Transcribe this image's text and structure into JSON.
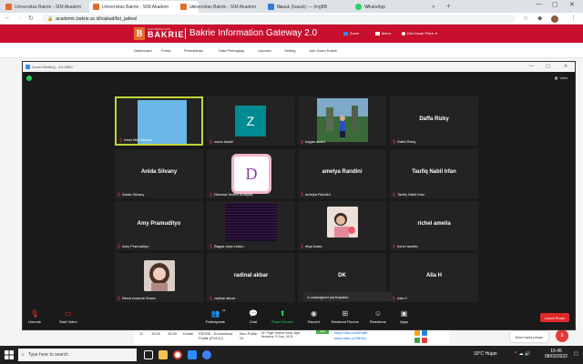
{
  "browser": {
    "tabs": [
      {
        "title": "Universitas Bakrie - SIM Akadem",
        "color": "#e46b2e",
        "active": false
      },
      {
        "title": "Universitas Bakrie - SIM Akadem",
        "color": "#e46b2e",
        "active": true
      },
      {
        "title": "Universitas Bakrie - SIM Akadem",
        "color": "#e46b2e",
        "active": false
      },
      {
        "title": "Baauk (baauk) — ImgBB",
        "color": "#2e7bd6",
        "active": false
      },
      {
        "title": "WhatsApp",
        "color": "#25d366",
        "active": false
      }
    ],
    "url": "academic.bakrie.ac.id/siakad/list_jadwal"
  },
  "site": {
    "logo_small": "UNIVERSITAS",
    "logo_big": "BAKRIE",
    "gateway_title": "Bakrie Information Gateway 2.0",
    "header_items": [
      "Zoom",
      "Menu",
      "Deri Ihsan Putra"
    ],
    "nav": [
      "Dashboard",
      "Portal",
      "Perkuliahan",
      "Data Pelengkap",
      "Laporan",
      "Setting",
      "Join Zoom Kuliah"
    ],
    "bg_row": {
      "no": "11",
      "start": "13:00",
      "end": "15:30",
      "type": "Kuliah",
      "course": "PSI206 - Komunikasi Politik (POL42)",
      "program": "Ilmu Politik S1",
      "lecturer": "Dr. Pajar Hatma Indra Jaya Nurseha, S.Sos., M.Si",
      "status": "Aktif",
      "link1": "https://lbk.co/b0Hqfb",
      "link2": "https://lbk.co/9fEfsX"
    },
    "chat_popup": "Kirim kami pesan",
    "chat_count": "9"
  },
  "zoom": {
    "title": "Zoom Meeting - A4-V86C",
    "view_label": "View",
    "unassigned": "4 unassigned participants",
    "tiles": [
      {
        "name": "Intan Mei Zahara",
        "big": "",
        "kind": "blue",
        "speaking": true
      },
      {
        "name": "zoom baal4",
        "big": "",
        "kind": "z"
      },
      {
        "name": "bagas akahl",
        "big": "",
        "kind": "photo"
      },
      {
        "name": "Daffa Rizky",
        "big": "Daffa Rizky",
        "kind": "text"
      },
      {
        "name": "Anida Silvany",
        "big": "Anida Silvany",
        "kind": "text"
      },
      {
        "name": "Dheana Vedha Nursyifa",
        "big": "",
        "kind": "d"
      },
      {
        "name": "amelya Randini",
        "big": "amelya Randini",
        "kind": "text"
      },
      {
        "name": "Taufiq Nabil Irfan",
        "big": "Taufiq Nabil Irfan",
        "kind": "text"
      },
      {
        "name": "Amy Pramudityo",
        "big": "Amy Pramudityo",
        "kind": "text"
      },
      {
        "name": "Bagas arya indaru",
        "big": "",
        "kind": "dark"
      },
      {
        "name": "rifqa lizara",
        "big": "",
        "kind": "girl"
      },
      {
        "name": "richel amelia",
        "big": "richel amelia",
        "kind": "text"
      },
      {
        "name": "Belva Ananda Shara",
        "big": "",
        "kind": "girl2"
      },
      {
        "name": "radinal akbar",
        "big": "radinal akbar",
        "kind": "text"
      },
      {
        "name": "",
        "big": "DK",
        "kind": "text"
      },
      {
        "name": "Alia H",
        "big": "Alia H",
        "kind": "text"
      }
    ],
    "toolbar": {
      "unmute": "Unmute",
      "start_video": "Start Video",
      "participants": "Participants",
      "participants_count": "16",
      "chat": "Chat",
      "share_screen": "Share Screen",
      "record": "Record",
      "breakout": "Breakout Rooms",
      "reactions": "Reactions",
      "apps": "Apps",
      "leave": "Leave Room"
    }
  },
  "taskbar": {
    "search_placeholder": "Type here to search",
    "weather": "33°C  Hujan",
    "time": "15:45",
    "date": "08/03/2022"
  }
}
